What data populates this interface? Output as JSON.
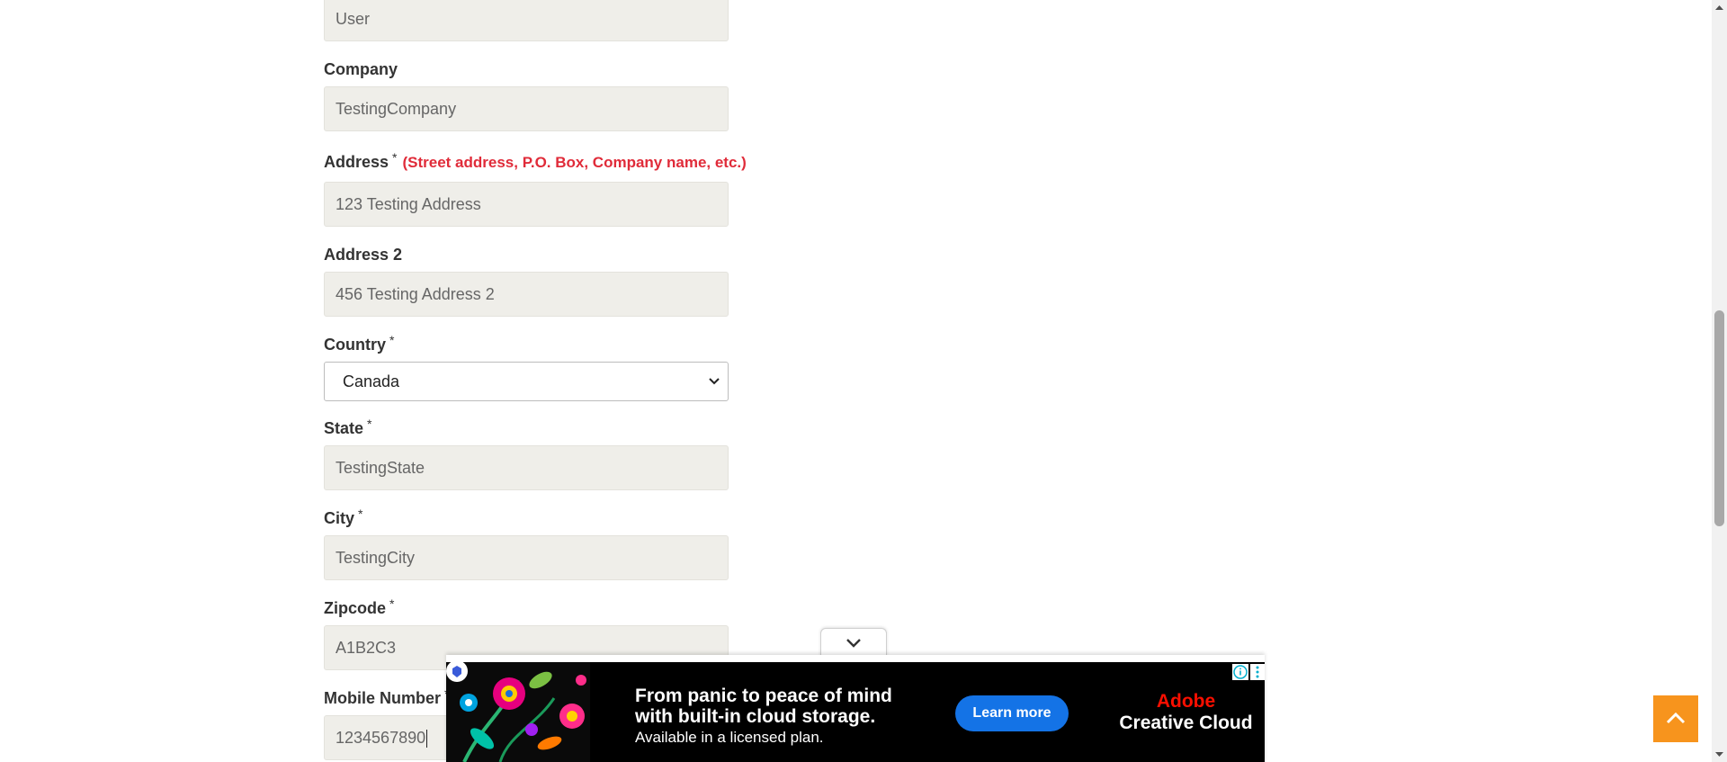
{
  "form": {
    "last_name": {
      "value": "User"
    },
    "company": {
      "label": "Company",
      "value": "TestingCompany"
    },
    "address": {
      "label": "Address",
      "required_mark": "*",
      "hint": "(Street address, P.O. Box, Company name, etc.)",
      "value": "123 Testing Address"
    },
    "address2": {
      "label": "Address 2",
      "value": "456 Testing Address 2"
    },
    "country": {
      "label": "Country",
      "required_mark": "*",
      "selected": "Canada"
    },
    "state": {
      "label": "State",
      "required_mark": "*",
      "value": "TestingState"
    },
    "city": {
      "label": "City",
      "required_mark": "*",
      "value": "TestingCity"
    },
    "zipcode": {
      "label": "Zipcode",
      "required_mark": "*",
      "value": "A1B2C3"
    },
    "mobile": {
      "label": "Mobile Number",
      "required_mark": "*",
      "value": "1234567890"
    }
  },
  "ad": {
    "headline": "From panic to peace of mind with built-in cloud storage.",
    "subtext": "Available in a licensed plan.",
    "cta": "Learn more",
    "brand_line1": "Adobe",
    "brand_line2": "Creative Cloud"
  },
  "colors": {
    "input_bg": "#efeee9",
    "hint_red": "#e02b39",
    "back_to_top": "#f7941d",
    "ad_cta": "#1473e6",
    "adobe_red": "#fa0f00"
  },
  "icons": {
    "back_to_top": "chevron-up-icon",
    "ad_collapse": "chevron-down-icon",
    "select_arrow": "chevron-down-icon",
    "ad_info": "info-icon",
    "ad_menu": "kebab-menu-icon"
  }
}
